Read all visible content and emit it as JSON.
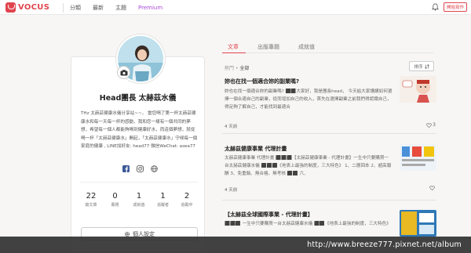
{
  "brand": {
    "name": "VOCUS",
    "color": "#e0454f"
  },
  "nav": {
    "items": [
      "分類",
      "最新",
      "主題",
      "Premium"
    ],
    "write_label": "開始寫作",
    "bell_icon": "bell-icon"
  },
  "profile": {
    "name": "Head團長 太赫茲水儀",
    "bio": "THz 太赫茲健康水儀分享站~~， 當您喝了第一杯太赫茲健康水和每一天每一杯的感動，我和您一樣有一個共同的夢想，希望每一個人都能夠喝到健康好水，而這個夢想，就從喝一杯「太赫茲健康水」開起，「太赫茲健康水」守候每一個家庭的健康 , LINE加好友: head77 微信WeChat: asea77",
    "settings_label": "個人設定",
    "stats": [
      {
        "value": "22",
        "label": "篇文章"
      },
      {
        "value": "0",
        "label": "專題"
      },
      {
        "value": "1",
        "label": "成就值"
      },
      {
        "value": "1",
        "label": "追蹤者"
      },
      {
        "value": "2",
        "label": "追蹤中"
      }
    ],
    "social_icons": [
      "facebook-icon",
      "instagram-icon",
      "website-icon"
    ]
  },
  "tabs": [
    "文章",
    "出版專題",
    "成就值"
  ],
  "filter": {
    "prefix": "熱門",
    "sep": "•",
    "value": "全部"
  },
  "sort_label": "排序",
  "posts": [
    {
      "title": "妳也在找一個適合妳的副業嗎?",
      "excerpt": "妳也在找一個適合妳的副業嗎? ⬛⬛大家好，我是團長head， 今天給大家講講如何選擇一個合適自己的副業，從而增加自己的收入，首先在選擇副業之前我們得認識自己，得足夠了解自己，才能找到最適合",
      "time": "4 天前",
      "likes": "3"
    },
    {
      "title": "太赫茲健康事業 代理計畫",
      "excerpt": "太赫茲健康事業 代理計畫 ⬛⬛⬛【太赫茲健康事業 - 代理計畫】一生中只要購買一台太赫茲健康水儀 ⬛⬛⬛《地表上最強的制度，三大特色》 1、二層回本 2、超高報酬 3、免重銷、無合格、無考核 ⬛⬛ 六、",
      "time": "4 天前",
      "likes": ""
    },
    {
      "title": "【太赫茲全球國際事業 - 代理計畫】",
      "excerpt": "⬛⬛⬛ 一生中只要購買一台太赫茲健康水儀 ⬛⬛《地表上最強的制度，三大特色》",
      "time": "",
      "likes": ""
    }
  ],
  "watermark": "http://www.breeze777.pixnet.net/album"
}
